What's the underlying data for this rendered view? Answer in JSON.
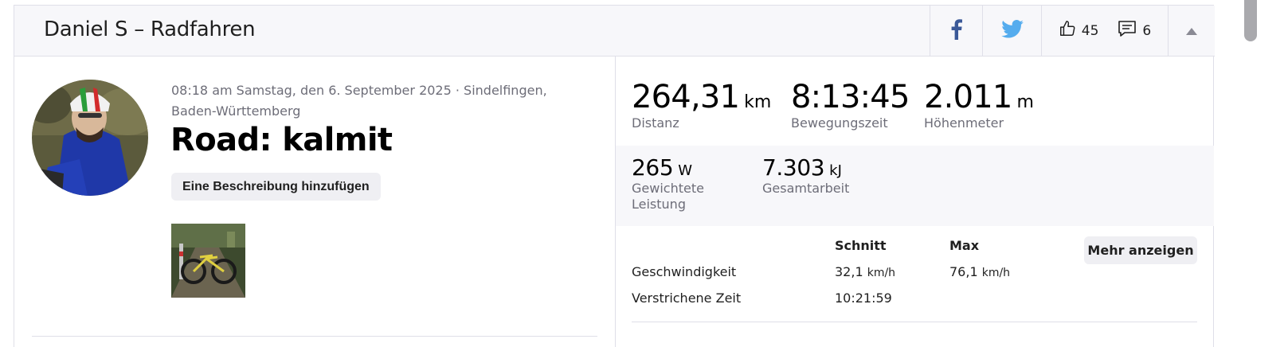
{
  "header": {
    "title": "Daniel S – Radfahren",
    "kudos_count": "45",
    "comments_count": "6",
    "icons": [
      "facebook-icon",
      "twitter-icon",
      "thumbs-up-icon",
      "comment-icon",
      "collapse-icon"
    ]
  },
  "activity": {
    "meta": "08:18 am Samstag, den 6. September 2025 · Sindelfingen, Baden-Württemberg",
    "name": "Road: kalmit",
    "description_button": "Eine Beschreibung hinzufügen"
  },
  "primary_stats": [
    {
      "value": "264,31",
      "unit": "km",
      "label": "Distanz"
    },
    {
      "value": "8:13:45",
      "unit": "",
      "label": "Bewegungszeit"
    },
    {
      "value": "2.011",
      "unit": "m",
      "label": "Höhenmeter"
    }
  ],
  "secondary_stats": [
    {
      "value": "265",
      "unit": "W",
      "label": "Gewichtete Leistung"
    },
    {
      "value": "7.303",
      "unit": "kJ",
      "label": "Gesamtarbeit"
    }
  ],
  "detail_table": {
    "headers": [
      "Schnitt",
      "Max"
    ],
    "rows": [
      {
        "label": "Geschwindigkeit",
        "avg": "32,1",
        "avg_unit": "km/h",
        "max": "76,1",
        "max_unit": "km/h"
      },
      {
        "label": "Verstrichene Zeit",
        "avg": "10:21:59",
        "avg_unit": "",
        "max": "",
        "max_unit": ""
      }
    ],
    "more_button": "Mehr anzeigen"
  },
  "colors": {
    "facebook": "#3b5998",
    "twitter": "#55acee",
    "header_bg": "#f7f7fa",
    "band_bg": "#f7f7fa",
    "button_bg": "#efeff3"
  }
}
